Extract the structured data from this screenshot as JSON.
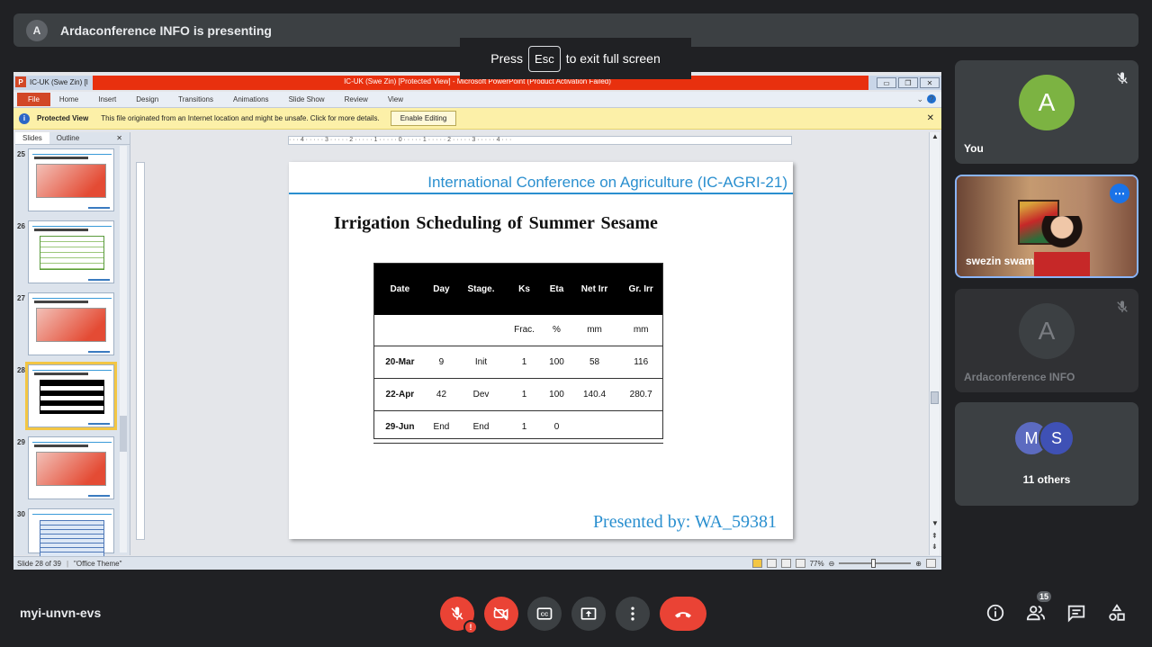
{
  "banner": {
    "avatar_letter": "A",
    "text": "Ardaconference INFO is presenting"
  },
  "esc_hint": {
    "prefix": "Press",
    "key": "Esc",
    "suffix": "to exit full screen"
  },
  "ppt": {
    "title_left": "IC-UK (Swe Zin) [I",
    "window_title": "IC-UK (Swe Zin) [Protected View] - Microsoft PowerPoint (Product Activation Failed)",
    "tabs": [
      "Home",
      "Insert",
      "Design",
      "Transitions",
      "Animations",
      "Slide Show",
      "Review",
      "View"
    ],
    "file_tab": "File",
    "protected_view": {
      "label": "Protected View",
      "message": "This file originated from an Internet location and might be unsafe. Click for more details.",
      "button": "Enable Editing"
    },
    "pane_tabs": {
      "slides": "Slides",
      "outline": "Outline"
    },
    "thumb_numbers": [
      "25",
      "26",
      "27",
      "28",
      "29",
      "30"
    ],
    "ruler_text": "· · · 4 · · · · · 3 · · · · · 2 · · · · · 1 · · · · · 0 · · · · · 1 · · · · · 2 · · · · · 3 · · · · · 4 · · ·",
    "status": {
      "slide": "Slide 28 of 39",
      "theme": "\"Office Theme\"",
      "zoom": "77%"
    }
  },
  "slide": {
    "conference": "International Conference on Agriculture (IC-AGRI-21)",
    "title": "Irrigation  Scheduling of Summer Sesame",
    "presented_by": "Presented by:  WA_59381",
    "table": {
      "headers": [
        "Date",
        "Day",
        "Stage.",
        "Ks",
        "Eta",
        "Net Irr",
        "Gr. Irr"
      ],
      "units": [
        "",
        "",
        "",
        "Frac.",
        "%",
        "mm",
        "mm"
      ],
      "rows": [
        [
          "20-Mar",
          "9",
          "Init",
          "1",
          "100",
          "58",
          "116"
        ],
        [
          "22-Apr",
          "42",
          "Dev",
          "1",
          "100",
          "140.4",
          "280.7"
        ],
        [
          "29-Jun",
          "End",
          "End",
          "1",
          "0",
          "",
          ""
        ]
      ]
    }
  },
  "participants": {
    "you": {
      "letter": "A",
      "name": "You"
    },
    "swezin": {
      "name": "swezin swam"
    },
    "arda": {
      "letter": "A",
      "name": "Ardaconference INFO"
    },
    "others": {
      "letters": [
        "M",
        "S"
      ],
      "label": "11 others"
    }
  },
  "meeting": {
    "code": "myi-unvn-evs",
    "people_count": "15"
  },
  "colors": {
    "hangup": "#ea4335",
    "accent": "#1a73e8",
    "slide_blue": "#2a8fcf"
  }
}
